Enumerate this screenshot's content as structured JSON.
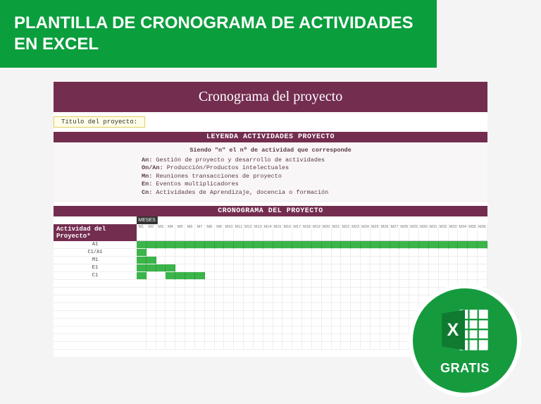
{
  "banner": {
    "line1": "PLANTILLA DE CRONOGRAMA DE ACTIVIDADES",
    "line2": "EN EXCEL"
  },
  "template": {
    "title": "Cronograma del proyecto",
    "project_title_label": "Título del proyecto:",
    "legend_header": "LEYENDA ACTIVIDADES PROYECTO",
    "legend_intro": "Siendo \"n\" el nº de actividad que corresponde",
    "legend_items": [
      {
        "key": "An:",
        "desc": "Gestión de proyecto y desarrollo de actividades"
      },
      {
        "key": "On/An:",
        "desc": "Producción/Productos intelectuales"
      },
      {
        "key": "Mn:",
        "desc": "Reuniones transacciones de proyecto"
      },
      {
        "key": "En:",
        "desc": "Eventos multiplicadores"
      },
      {
        "key": "Cn:",
        "desc": "Actividades de Aprendizaje, docencia o formación"
      }
    ],
    "gantt_header": "CRONOGRAMA DEL PROYECTO",
    "month_label": "MESES",
    "ticks": [
      "M1",
      "M2",
      "M3",
      "M4",
      "M5",
      "M6",
      "M7",
      "M8",
      "M9",
      "M10",
      "M11",
      "M12",
      "M13",
      "M14",
      "M15",
      "M16",
      "M17",
      "M18",
      "M19",
      "M20",
      "M21",
      "M22",
      "M23",
      "M24",
      "M25",
      "M26",
      "M27",
      "M28",
      "M29",
      "M30",
      "M31",
      "M32",
      "M33",
      "M34",
      "M35",
      "M36"
    ],
    "activity_header": "Actividad del Proyecto*",
    "rows": [
      {
        "label": "A1",
        "cells": [
          1,
          1,
          1,
          1,
          1,
          1,
          1,
          1,
          1,
          1,
          1,
          1,
          1,
          1,
          1,
          1,
          1,
          1,
          1,
          1,
          1,
          1,
          1,
          1,
          1,
          1,
          1,
          1,
          1,
          1,
          1,
          1,
          1,
          1,
          1,
          1
        ]
      },
      {
        "label": "C1/A1",
        "cells": [
          1,
          0,
          0,
          0,
          0,
          0,
          0,
          0,
          0,
          0,
          0,
          0,
          0,
          0,
          0,
          0,
          0,
          0,
          0,
          0,
          0,
          0,
          0,
          0,
          0,
          0,
          0,
          0,
          0,
          0,
          0,
          0,
          0,
          0,
          0,
          0
        ]
      },
      {
        "label": "M1",
        "cells": [
          1,
          1,
          0,
          0,
          0,
          0,
          0,
          0,
          0,
          0,
          0,
          0,
          0,
          0,
          0,
          0,
          0,
          0,
          0,
          0,
          0,
          0,
          0,
          0,
          0,
          0,
          0,
          0,
          0,
          0,
          0,
          0,
          0,
          0,
          0,
          0
        ]
      },
      {
        "label": "E1",
        "cells": [
          1,
          1,
          1,
          1,
          0,
          0,
          0,
          0,
          0,
          0,
          0,
          0,
          0,
          0,
          0,
          0,
          0,
          0,
          0,
          0,
          0,
          0,
          0,
          0,
          0,
          0,
          0,
          0,
          0,
          0,
          0,
          0,
          0,
          0,
          0,
          0
        ]
      },
      {
        "label": "C1",
        "cells": [
          1,
          0,
          0,
          1,
          1,
          1,
          1,
          0,
          0,
          0,
          0,
          0,
          0,
          0,
          0,
          0,
          0,
          0,
          0,
          0,
          0,
          0,
          0,
          0,
          0,
          0,
          0,
          0,
          0,
          0,
          0,
          0,
          0,
          0,
          0,
          0
        ]
      },
      {
        "label": "",
        "cells": [
          0,
          0,
          0,
          0,
          0,
          0,
          0,
          0,
          0,
          0,
          0,
          0,
          0,
          0,
          0,
          0,
          0,
          0,
          0,
          0,
          0,
          0,
          0,
          0,
          0,
          0,
          0,
          0,
          0,
          0,
          0,
          0,
          0,
          0,
          0,
          0
        ]
      },
      {
        "label": "",
        "cells": [
          0,
          0,
          0,
          0,
          0,
          0,
          0,
          0,
          0,
          0,
          0,
          0,
          0,
          0,
          0,
          0,
          0,
          0,
          0,
          0,
          0,
          0,
          0,
          0,
          0,
          0,
          0,
          0,
          0,
          0,
          0,
          0,
          0,
          0,
          0,
          0
        ]
      },
      {
        "label": "",
        "cells": [
          0,
          0,
          0,
          0,
          0,
          0,
          0,
          0,
          0,
          0,
          0,
          0,
          0,
          0,
          0,
          0,
          0,
          0,
          0,
          0,
          0,
          0,
          0,
          0,
          0,
          0,
          0,
          0,
          0,
          0,
          0,
          0,
          0,
          0,
          0,
          0
        ]
      },
      {
        "label": "",
        "cells": [
          0,
          0,
          0,
          0,
          0,
          0,
          0,
          0,
          0,
          0,
          0,
          0,
          0,
          0,
          0,
          0,
          0,
          0,
          0,
          0,
          0,
          0,
          0,
          0,
          0,
          0,
          0,
          0,
          0,
          0,
          0,
          0,
          0,
          0,
          0,
          0
        ]
      },
      {
        "label": "",
        "cells": [
          0,
          0,
          0,
          0,
          0,
          0,
          0,
          0,
          0,
          0,
          0,
          0,
          0,
          0,
          0,
          0,
          0,
          0,
          0,
          0,
          0,
          0,
          0,
          0,
          0,
          0,
          0,
          0,
          0,
          0,
          0,
          0,
          0,
          0,
          0,
          0
        ]
      },
      {
        "label": "",
        "cells": [
          0,
          0,
          0,
          0,
          0,
          0,
          0,
          0,
          0,
          0,
          0,
          0,
          0,
          0,
          0,
          0,
          0,
          0,
          0,
          0,
          0,
          0,
          0,
          0,
          0,
          0,
          0,
          0,
          0,
          0,
          0,
          0,
          0,
          0,
          0,
          0
        ]
      },
      {
        "label": "",
        "cells": [
          0,
          0,
          0,
          0,
          0,
          0,
          0,
          0,
          0,
          0,
          0,
          0,
          0,
          0,
          0,
          0,
          0,
          0,
          0,
          0,
          0,
          0,
          0,
          0,
          0,
          0,
          0,
          0,
          0,
          0,
          0,
          0,
          0,
          0,
          0,
          0
        ]
      },
      {
        "label": "",
        "cells": [
          0,
          0,
          0,
          0,
          0,
          0,
          0,
          0,
          0,
          0,
          0,
          0,
          0,
          0,
          0,
          0,
          0,
          0,
          0,
          0,
          0,
          0,
          0,
          0,
          0,
          0,
          0,
          0,
          0,
          0,
          0,
          0,
          0,
          0,
          0,
          0
        ]
      },
      {
        "label": "",
        "cells": [
          0,
          0,
          0,
          0,
          0,
          0,
          0,
          0,
          0,
          0,
          0,
          0,
          0,
          0,
          0,
          0,
          0,
          0,
          0,
          0,
          0,
          0,
          0,
          0,
          0,
          0,
          0,
          0,
          0,
          0,
          0,
          0,
          0,
          0,
          0,
          0
        ]
      }
    ]
  },
  "badge": {
    "label": "GRATIS"
  }
}
